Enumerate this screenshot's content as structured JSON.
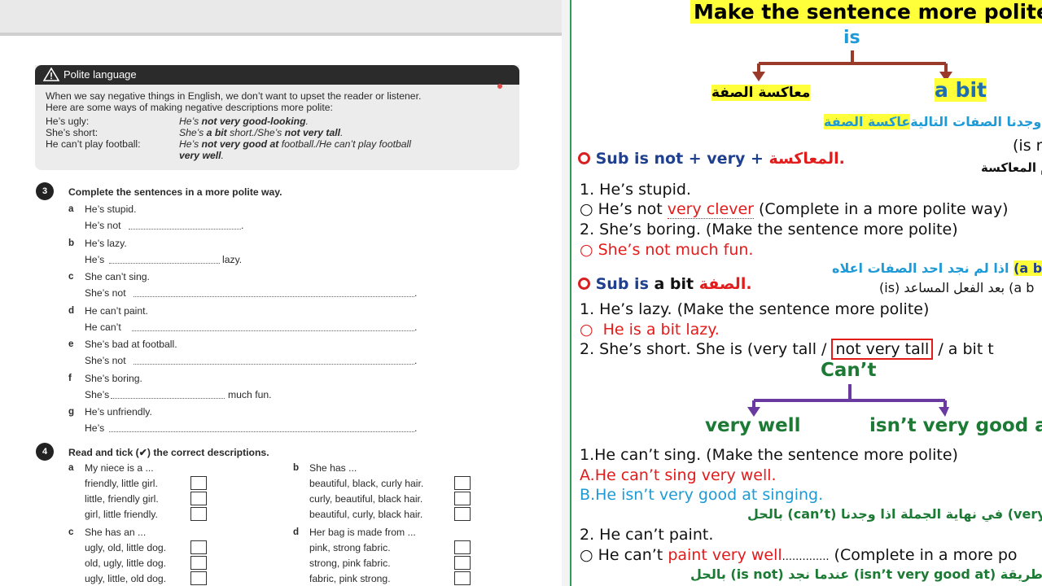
{
  "left": {
    "box": {
      "title": "Polite language",
      "intro1": "When we say negative things in English, we don’t want to upset the reader or listener.",
      "intro2": "Here are some ways of making negative descriptions more polite:",
      "rows": [
        {
          "label": "He’s ugly:",
          "p1": "He’s ",
          "b1": "not very good-looking",
          "p2": ".",
          "b2": "",
          "p3": "",
          "b3": "",
          "p4": ""
        },
        {
          "label": "She’s short:",
          "p1": "She’s ",
          "b1": "a bit",
          "p2": " short./She’s ",
          "b2": "not very tall",
          "p3": ".",
          "b3": "",
          "p4": ""
        },
        {
          "label": "He can’t play football:",
          "p1": "He’s ",
          "b1": "not very good at",
          "p2": " football./He can’t play football",
          "b2": "",
          "p3": "",
          "b3": "",
          "p4": ""
        }
      ],
      "row3_cont": "very well",
      "row3_end": "."
    },
    "ex3": {
      "number": "3",
      "instruction": "Complete the sentences in a more polite way.",
      "items": [
        {
          "letter": "a",
          "q": "He’s stupid.",
          "a_start": "He’s not",
          "a_end": "."
        },
        {
          "letter": "b",
          "q": "He’s lazy.",
          "a_start": "He’s",
          "a_end": "lazy."
        },
        {
          "letter": "c",
          "q": "She can’t sing.",
          "a_start": "She’s not",
          "a_end": "."
        },
        {
          "letter": "d",
          "q": "He can’t paint.",
          "a_start": "He can’t",
          "a_end": "."
        },
        {
          "letter": "e",
          "q": "She’s bad at football.",
          "a_start": "She’s not",
          "a_end": "."
        },
        {
          "letter": "f",
          "q": "She’s boring.",
          "a_start": "She’s",
          "a_end": "much fun."
        },
        {
          "letter": "g",
          "q": "He’s unfriendly.",
          "a_start": "He’s",
          "a_end": "."
        }
      ]
    },
    "ex4": {
      "number": "4",
      "instruction_a": "Read and tick (",
      "tick": "✔",
      "instruction_b": ") the correct descriptions.",
      "groups": [
        {
          "letter": "a",
          "title": "My niece is a ...",
          "options": [
            "friendly, little girl.",
            "little, friendly girl.",
            "girl, little friendly."
          ]
        },
        {
          "letter": "b",
          "title": "She has ...",
          "options": [
            "beautiful, black, curly hair.",
            "curly, beautiful, black hair.",
            "beautiful, curly, black hair."
          ]
        },
        {
          "letter": "c",
          "title": "She has an ...",
          "options": [
            "ugly, old, little dog.",
            "old, ugly, little dog.",
            "ugly, little, old dog."
          ]
        },
        {
          "letter": "d",
          "title": "Her bag is made from ...",
          "options": [
            "pink, strong fabric.",
            "strong, pink fabric.",
            "fabric, pink strong."
          ]
        }
      ]
    }
  },
  "right": {
    "title": "Make the sentence more polite",
    "is": "is",
    "opposite_ar": "معاكسة الصفة",
    "a_bit": "a bit",
    "ar_line1_hl": "عاكسة الصفة",
    "ar_line1_rest": " اذا وجدنا الصفات التالية",
    "is_cut": "(is r",
    "ar_cut1": "م المعاكسة",
    "rule1_sub": "Sub is not + very + ",
    "rule1_ar": "المعاكسة.",
    "s1": "1. He’s stupid.",
    "s1_pre": "He’s not ",
    "s1_red": "very clever",
    "s1_post": " (Complete in a more polite way)",
    "s2": "2. She’s boring. (Make the sentence more polite)",
    "s2_ans": "She’s not much fun.",
    "ar_line2": "اذا لم نجد احد الصفات اعلاه ",
    "ar_line2_hl": "(a bit",
    "rule2_sub": "Sub is ",
    "rule2_bit": "a bit",
    "rule2_ar": " الصفة.",
    "ar_line3": "(is) بعد الفعل المساعد (a b",
    "s3": "1. He’s lazy. (Make the sentence more polite)",
    "s3_ans": "He is a bit lazy.",
    "s4_pre": "2. She’s short. She is (very tall / ",
    "s4_box": "not very tall",
    "s4_post": " / a bit t",
    "cant": "Can’t",
    "very_well": "very well",
    "isnt_very_good": "isn’t very good a",
    "s5": "1.He can’t sing. (Make the sentence more polite)",
    "s5_a": "A.He can’t sing very well.",
    "s5_b": "B.He isn’t very good at singing.",
    "ar_line4": "بالحل (can’t) في نهاية الجملة اذا وجدنا (very w",
    "s6": "2. He can’t paint.",
    "s6_pre": "He can’t ",
    "s6_red": "paint very well",
    "s6_dots": "..............",
    "s6_post": " (Complete in a more po",
    "ar_line5": "بالحل (is not) عندما نجد (isn’t very good at) طريقة"
  }
}
